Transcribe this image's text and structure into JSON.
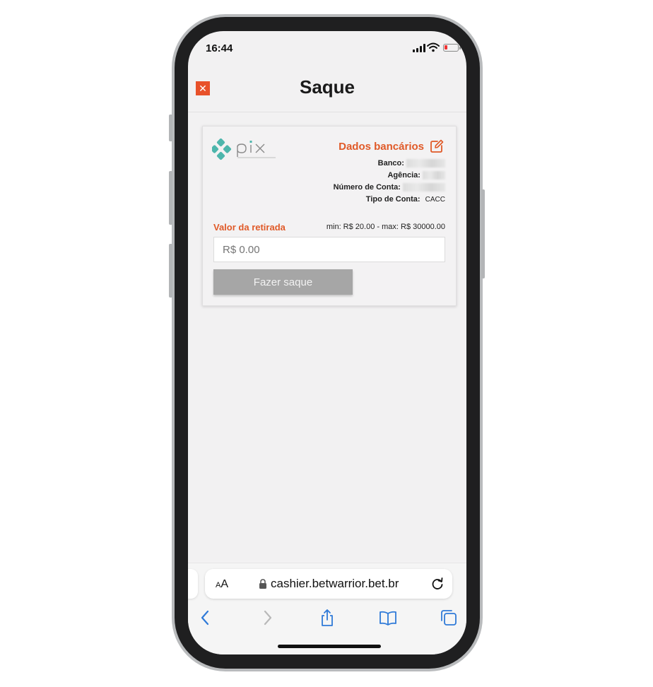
{
  "status_bar": {
    "time": "16:44"
  },
  "header": {
    "title": "Saque",
    "close_symbol": "✕"
  },
  "bank_card": {
    "title": "Dados bancários",
    "fields": [
      {
        "label": "Banco:",
        "value": ""
      },
      {
        "label": "Agência:",
        "value": ""
      },
      {
        "label": "Número de Conta:",
        "value": ""
      },
      {
        "label": "Tipo de Conta:",
        "value": "CACC"
      }
    ],
    "amount_label": "Valor da retirada",
    "limits": "min: R$ 20.00 - max: R$ 30000.00",
    "amount_placeholder": "R$ 0.00",
    "submit_label": "Fazer saque"
  },
  "browser": {
    "text_size_small": "A",
    "text_size_large": "A",
    "url": "cashier.betwarrior.bet.br"
  },
  "colors": {
    "accent": "#e05a28",
    "pix_teal": "#4db6ac",
    "button_disabled": "#a6a6a6",
    "link_blue": "#2f7ad8"
  }
}
